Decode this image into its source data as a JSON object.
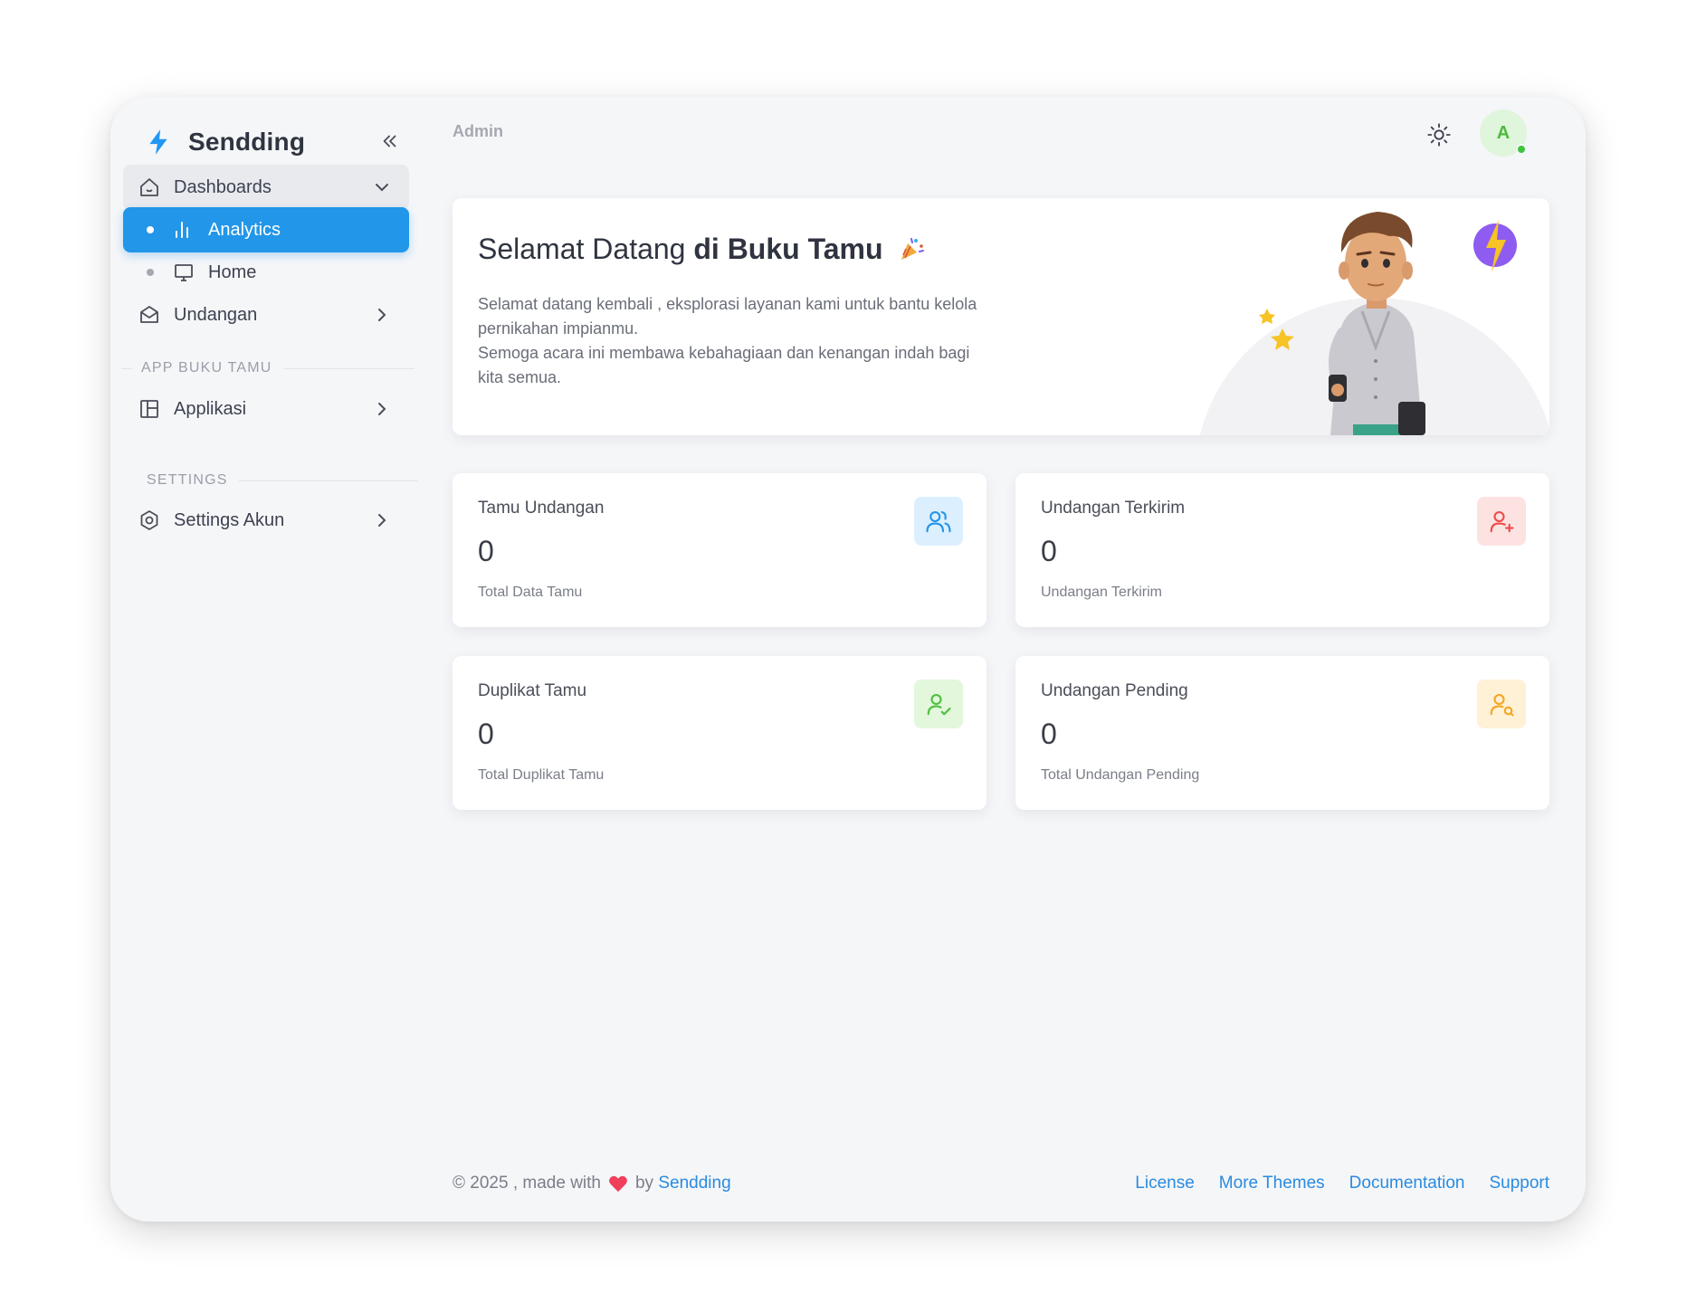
{
  "brand": {
    "name": "Sendding",
    "logo_icon": "bolt-icon",
    "accent": "#2196f3"
  },
  "topbar": {
    "title": "Admin",
    "avatar_initial": "A",
    "status_color": "#3fc43a"
  },
  "sidebar": {
    "dashboards_label": "Dashboards",
    "analytics_label": "Analytics",
    "home_label": "Home",
    "undangan_label": "Undangan",
    "section_app": "APP BUKU TAMU",
    "aplikasi_label": "Applikasi",
    "section_settings": "SETTINGS",
    "settings_label": "Settings Akun"
  },
  "welcome": {
    "title_prefix": "Selamat Datang ",
    "title_bold": "di Buku Tamu",
    "line1": "Selamat datang kembali , eksplorasi layanan kami untuk bantu kelola pernikahan impianmu.",
    "line2": "Semoga acara ini membawa kebahagiaan dan kenangan indah bagi kita semua."
  },
  "stats": [
    {
      "label": "Tamu Undangan",
      "value": "0",
      "sub": "Total Data Tamu",
      "icon": "users-icon",
      "color": "#2296e8",
      "bg": "#dcefff"
    },
    {
      "label": "Undangan Terkirim",
      "value": "0",
      "sub": "Undangan Terkirim",
      "icon": "user-plus-icon",
      "color": "#ef4b4b",
      "bg": "#fde2e2"
    },
    {
      "label": "Duplikat Tamu",
      "value": "0",
      "sub": "Total Duplikat Tamu",
      "icon": "user-check-icon",
      "color": "#4fbf3f",
      "bg": "#e2f7dc"
    },
    {
      "label": "Undangan Pending",
      "value": "0",
      "sub": "Total Undangan Pending",
      "icon": "user-search-icon",
      "color": "#f5a623",
      "bg": "#fff1d6"
    }
  ],
  "footer": {
    "copyright": "© 2025 , made with",
    "by": "by",
    "brand_link": "Sendding",
    "links": [
      "License",
      "More Themes",
      "Documentation",
      "Support"
    ]
  }
}
